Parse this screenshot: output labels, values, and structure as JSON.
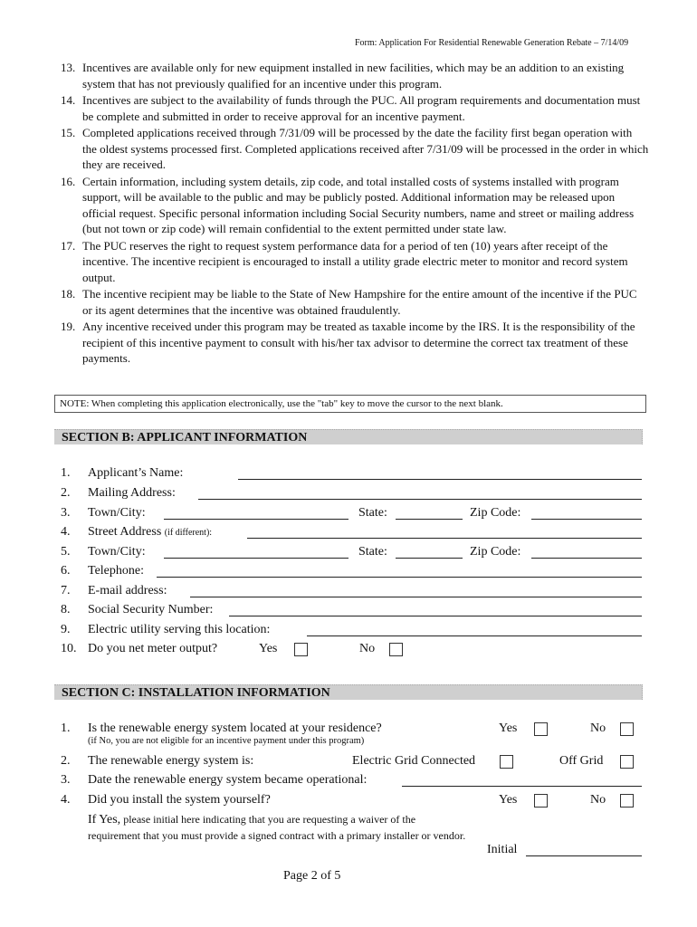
{
  "header": {
    "form_title": "Form: Application For Residential Renewable Generation Rebate – 7/14/09"
  },
  "terms": [
    {
      "num": "13.",
      "text": "Incentives are available only for new equipment installed in new facilities, which may be an addition to an existing system that has not previously qualified for an incentive under this program."
    },
    {
      "num": "14.",
      "text": "Incentives are subject to the availability of funds through the PUC.  All program requirements and documentation must be complete and submitted in order to receive approval for an incentive payment."
    },
    {
      "num": "15.",
      "text": "Completed applications received through 7/31/09 will be processed by the date the facility first began operation with the oldest systems processed first.  Completed applications received after 7/31/09 will be processed in the order in which they are received."
    },
    {
      "num": "16.",
      "text": "Certain information, including system details, zip code, and total installed costs of systems installed with program support, will be available to the public and may be publicly posted.  Additional information may be released upon official request.  Specific personal information including Social Security numbers, name and street or mailing address (but not town or zip code) will remain confidential to the extent permitted under state law."
    },
    {
      "num": "17.",
      "text": "The PUC reserves the right to request system performance data for a period of ten (10) years after receipt of the incentive.  The incentive recipient is encouraged to install a utility grade electric meter to monitor and record system output."
    },
    {
      "num": "18.",
      "text": "The incentive recipient may be liable to the State of New Hampshire for the entire amount of the incentive if the PUC or its agent determines that the incentive was obtained fraudulently."
    },
    {
      "num": "19.",
      "text": "Any incentive received under this program may be treated as taxable income by the IRS.  It is the responsibility of the recipient of this incentive payment to consult with his/her tax advisor to determine the correct tax treatment of these payments."
    }
  ],
  "note": "NOTE:  When completing this application electronically, use the \"tab\" key to move the cursor to the next blank.",
  "section_b": {
    "title": "SECTION B:  APPLICANT INFORMATION",
    "fields": {
      "applicant_name": {
        "num": "1.",
        "label": "Applicant’s Name:",
        "value": ""
      },
      "mailing_address": {
        "num": "2.",
        "label": "Mailing Address:",
        "value": ""
      },
      "town_city_1": {
        "num": "3.",
        "label": "Town/City:",
        "value": ""
      },
      "state_1": {
        "label": "State:",
        "value": ""
      },
      "zip_1": {
        "label": "Zip Code:",
        "value": ""
      },
      "street_address": {
        "num": "4.",
        "label": "Street Address",
        "label_small": "(if different):",
        "value": ""
      },
      "town_city_2": {
        "num": "5.",
        "label": "Town/City:",
        "value": ""
      },
      "state_2": {
        "label": "State:",
        "value": ""
      },
      "zip_2": {
        "label": "Zip Code:",
        "value": ""
      },
      "telephone": {
        "num": "6.",
        "label": "Telephone:",
        "value": ""
      },
      "email": {
        "num": "7.",
        "label": "E-mail address:",
        "value": ""
      },
      "ssn": {
        "num": "8.",
        "label": "Social Security Number:",
        "value": ""
      },
      "utility": {
        "num": "9.",
        "label": "Electric utility serving this location:",
        "value": ""
      },
      "net_meter": {
        "num": "10.",
        "label": "Do you net meter output?",
        "yes_label": "Yes",
        "no_label": "No",
        "yes_checked": false,
        "no_checked": false
      }
    }
  },
  "section_c": {
    "title": "SECTION C:  INSTALLATION INFORMATION",
    "q1": {
      "num": "1.",
      "label": "Is the renewable energy system located at your residence?",
      "note": "(if No, you are not eligible for an incentive payment under this program)",
      "yes_label": "Yes",
      "no_label": "No"
    },
    "q2": {
      "num": "2.",
      "label": "The renewable energy system is:",
      "opt1_label": "Electric Grid Connected",
      "opt2_label": "Off Grid"
    },
    "q3": {
      "num": "3.",
      "label": "Date the renewable energy system became operational:",
      "value": ""
    },
    "q4": {
      "num": "4.",
      "label": "Did you install the system yourself?",
      "yes_label": "Yes",
      "no_label": "No"
    },
    "waiver": {
      "lead": "If Yes,",
      "text": " please initial here indicating that you are requesting a waiver of the requirement that you must provide a signed contract with a primary installer or vendor.",
      "initial_label": "Initial",
      "value": ""
    }
  },
  "footer": {
    "page": "Page 2 of 5"
  }
}
